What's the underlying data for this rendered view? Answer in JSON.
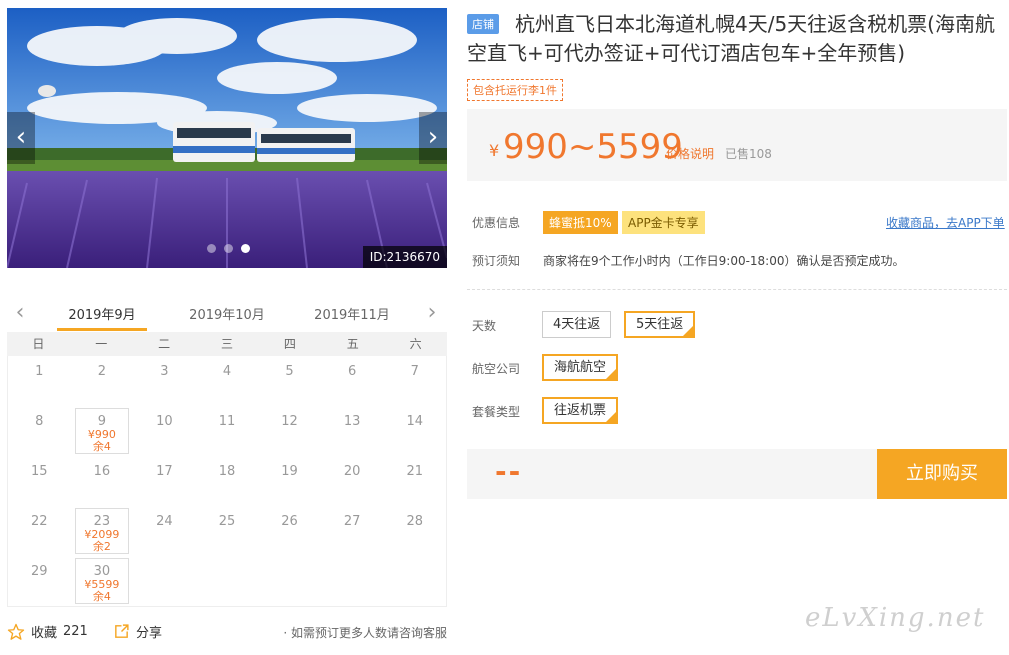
{
  "photo": {
    "id_label": "ID:2136670",
    "prev_icon": "chevron-left-icon",
    "next_icon": "chevron-right-icon",
    "dots": 3,
    "active_dot": 2
  },
  "calendar": {
    "months": [
      "2019年9月",
      "2019年10月",
      "2019年11月"
    ],
    "active_month": 0,
    "weekdays": [
      "日",
      "一",
      "二",
      "三",
      "四",
      "五",
      "六"
    ],
    "first_weekday": 0,
    "days_in_month": 30,
    "priced_days": [
      {
        "day": "9",
        "price": "¥990",
        "left": "余4"
      },
      {
        "day": "23",
        "price": "¥2099",
        "left": "余2"
      },
      {
        "day": "30",
        "price": "¥5599",
        "left": "余4"
      }
    ]
  },
  "bottom": {
    "fav_label": "收藏",
    "fav_count": "221",
    "share_label": "分享",
    "hint": "· 如需预订更多人数请咨询客服"
  },
  "product": {
    "shop_tag": "店铺",
    "title": "杭州直飞日本北海道札幌4天/5天往返含税机票(海南航空直飞+可代办签证+可代订酒店包车+全年预售)",
    "baggage_tag": "包含托运行李1件"
  },
  "price": {
    "yen": "¥",
    "range": "990~5599",
    "explain": "价格说明",
    "sold": "已售108"
  },
  "info": {
    "promo_label": "优惠信息",
    "promo_1": "蜂蜜抵10%",
    "promo_2": "APP金卡专享",
    "app_link": "收藏商品，去APP下单",
    "notice_label": "预订须知",
    "notice": "商家将在9个工作小时内（工作日9:00-18:00）确认是否预定成功。"
  },
  "options": {
    "days_label": "天数",
    "days": [
      "4天往返",
      "5天往返"
    ],
    "days_selected": 1,
    "airline_label": "航空公司",
    "airline": "海航航空",
    "package_label": "套餐类型",
    "package": "往返机票"
  },
  "buy": {
    "placeholder": "--",
    "button": "立即购买"
  },
  "watermark": "eLvXing.net",
  "colors": {
    "accent": "#f5a623",
    "price": "#f0772e",
    "link": "#3a78c9",
    "shop_tag": "#5b9ce8"
  }
}
